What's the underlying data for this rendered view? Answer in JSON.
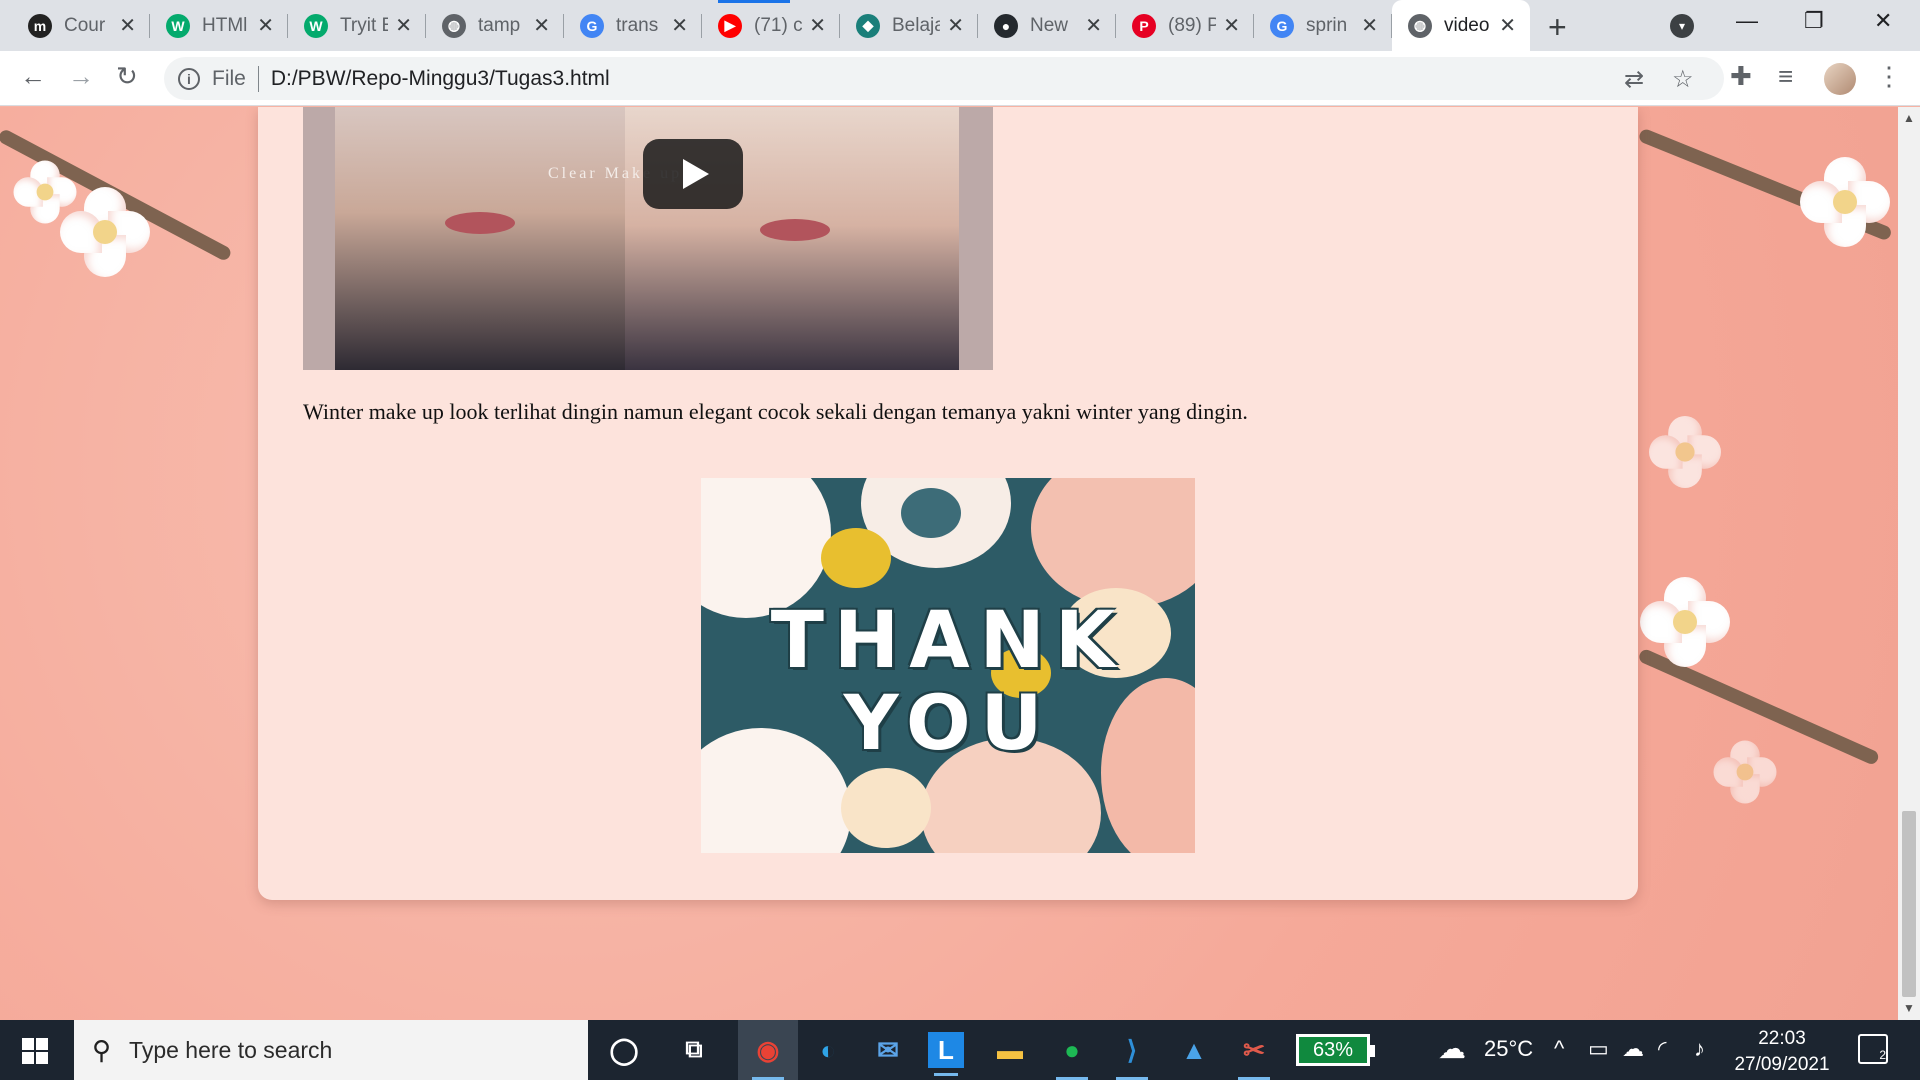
{
  "browser": {
    "tabs": [
      {
        "label": "Cour",
        "icon": "moodle-icon",
        "icon_glyph": "m",
        "icon_color": "#222222"
      },
      {
        "label": "HTMl",
        "icon": "w3schools-icon",
        "icon_glyph": "W",
        "icon_color": "#04aa6d"
      },
      {
        "label": "Tryit E",
        "icon": "w3schools-icon",
        "icon_glyph": "W",
        "icon_color": "#04aa6d"
      },
      {
        "label": "tamp",
        "icon": "globe-icon",
        "icon_glyph": "◍",
        "icon_color": "#5f6368"
      },
      {
        "label": "trans",
        "icon": "google-icon",
        "icon_glyph": "G",
        "icon_color": "#4285f4"
      },
      {
        "label": "(71) c",
        "icon": "youtube-icon",
        "icon_glyph": "▶",
        "icon_color": "#ff0000"
      },
      {
        "label": "Belaja",
        "icon": "belajar-icon",
        "icon_glyph": "◆",
        "icon_color": "#1a7f7a"
      },
      {
        "label": "New",
        "icon": "github-icon",
        "icon_glyph": "●",
        "icon_color": "#24292e"
      },
      {
        "label": "(89) P",
        "icon": "pinterest-icon",
        "icon_glyph": "P",
        "icon_color": "#e60023"
      },
      {
        "label": "sprin",
        "icon": "google-icon",
        "icon_glyph": "G",
        "icon_color": "#4285f4"
      },
      {
        "label": "video",
        "icon": "globe-icon",
        "icon_glyph": "◍",
        "icon_color": "#5f6368",
        "active": true
      }
    ],
    "close_glyph": "✕",
    "new_tab_glyph": "+",
    "window_controls": {
      "minimize": "—",
      "restore": "❐",
      "close": "✕"
    },
    "nav": {
      "back": "←",
      "forward": "→",
      "reload": "↻"
    },
    "address": {
      "scheme_label": "File",
      "url": "D:/PBW/Repo-Minggu3/Tugas3.html"
    },
    "toolbar_icons": {
      "translate": "⇄",
      "star": "☆",
      "extensions": "✚",
      "media": "≡",
      "menu": "⋮"
    }
  },
  "page": {
    "video": {
      "caption": "Clear Make up",
      "play_label": "Play video"
    },
    "paragraph": "Winter make up look terlihat dingin namun elegant cocok sekali dengan temanya yakni winter yang dingin.",
    "thank_you": {
      "line1": "THANK",
      "line2": "YOU"
    },
    "colors": {
      "card": "#fde3dc",
      "background": "#f5a999",
      "thank_you_bg": "#2d5b66"
    }
  },
  "taskbar": {
    "search_placeholder": "Type here to search",
    "apps": [
      "cortana-icon",
      "task-view-icon",
      "chrome-icon",
      "edge-icon",
      "mail-icon",
      "l-app-icon",
      "file-explorer-icon",
      "spotify-icon",
      "vscode-icon",
      "photos-icon",
      "snip-icon"
    ],
    "battery_percent": "63%",
    "weather": "25°C",
    "time": "22:03",
    "date": "27/09/2021",
    "notification_count": "2"
  }
}
